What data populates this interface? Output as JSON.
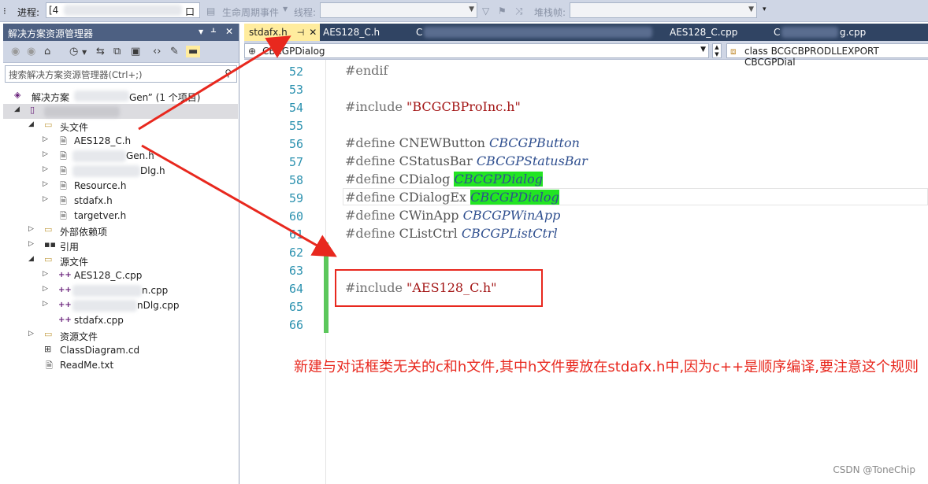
{
  "topbar": {
    "process_label": "进程:",
    "process_value": "[4",
    "process_suffix": "口",
    "lifecycle_label": "生命周期事件",
    "thread_label": "线程:",
    "stackframe_label": "堆栈帧:"
  },
  "solution_explorer": {
    "title": "解决方案资源管理器",
    "search_placeholder": "搜索解决方案资源管理器(Ctrl+;)",
    "solution_label": "解决方案",
    "solution_suffix": "Gen” (1 个项目)",
    "project_name": "",
    "tree": [
      {
        "label": "头文件",
        "kind": "folder"
      },
      {
        "label": "AES128_C.h",
        "kind": "h"
      },
      {
        "label": "Gen.h",
        "kind": "h"
      },
      {
        "label": "Dlg.h",
        "kind": "h"
      },
      {
        "label": "Resource.h",
        "kind": "h"
      },
      {
        "label": "stdafx.h",
        "kind": "h"
      },
      {
        "label": "targetver.h",
        "kind": "h"
      },
      {
        "label": "外部依赖项",
        "kind": "ext"
      },
      {
        "label": "引用",
        "kind": "ref"
      },
      {
        "label": "源文件",
        "kind": "folder"
      },
      {
        "label": "AES128_C.cpp",
        "kind": "cpp"
      },
      {
        "label": "n.cpp",
        "kind": "cpp"
      },
      {
        "label": "nDlg.cpp",
        "kind": "cpp"
      },
      {
        "label": "stdafx.cpp",
        "kind": "cpp"
      },
      {
        "label": "资源文件",
        "kind": "folder"
      },
      {
        "label": "ClassDiagram.cd",
        "kind": "cd"
      },
      {
        "label": "ReadMe.txt",
        "kind": "txt"
      }
    ]
  },
  "editor": {
    "tabs": [
      {
        "label": "stdafx.h",
        "active": true
      },
      {
        "label": "AES128_C.h",
        "active": false
      },
      {
        "label": "C",
        "active": false
      },
      {
        "label": "AES128_C.cpp",
        "active": false
      },
      {
        "label": "C",
        "active": false
      },
      {
        "label": "g.cpp",
        "active": false
      }
    ],
    "nav_left": "CBCGPDialog",
    "nav_right": "class BCGCBPRODLLEXPORT CBCGPDial",
    "lines": [
      {
        "n": "52",
        "pre": "#endif",
        "name": "",
        "val": "",
        "hl": false
      },
      {
        "n": "53",
        "pre": "",
        "name": "",
        "val": "",
        "hl": false
      },
      {
        "n": "54",
        "pre": "#include ",
        "str": "\"BCGCBProInc.h\"",
        "name": "",
        "val": "",
        "hl": false
      },
      {
        "n": "55",
        "pre": "",
        "name": "",
        "val": "",
        "hl": false
      },
      {
        "n": "56",
        "pre": "#define ",
        "name": "CNEWButton ",
        "val": "CBCGPButton",
        "hl": false
      },
      {
        "n": "57",
        "pre": "#define ",
        "name": "CStatusBar ",
        "val": "CBCGPStatusBar",
        "hl": false
      },
      {
        "n": "58",
        "pre": "#define ",
        "name": "CDialog ",
        "val": "CBCGPDialog",
        "hl": true
      },
      {
        "n": "59",
        "pre": "#define ",
        "name": "CDialogEx ",
        "val": "CBCGPDialog",
        "hl": true
      },
      {
        "n": "60",
        "pre": "#define ",
        "name": "CWinApp ",
        "val": "CBCGPWinApp",
        "hl": false
      },
      {
        "n": "61",
        "pre": "#define ",
        "name": "CListCtrl ",
        "val": "CBCGPListCtrl",
        "hl": false
      },
      {
        "n": "62",
        "pre": "",
        "name": "",
        "val": "",
        "hl": false
      },
      {
        "n": "63",
        "pre": "",
        "name": "",
        "val": "",
        "hl": false
      },
      {
        "n": "64",
        "pre": "#include ",
        "str": "\"AES128_C.h\"",
        "name": "",
        "val": "",
        "hl": false
      },
      {
        "n": "65",
        "pre": "",
        "name": "",
        "val": "",
        "hl": false
      },
      {
        "n": "66",
        "pre": "",
        "name": "",
        "val": "",
        "hl": false
      }
    ]
  },
  "annotation": {
    "note": "新建与对话框类无关的c和h文件,其中h文件要放在stdafx.h中,因为c++是顺序编译,要注意这个规则",
    "arrow_color": "#e8281e"
  },
  "watermark": "CSDN @ToneChip"
}
